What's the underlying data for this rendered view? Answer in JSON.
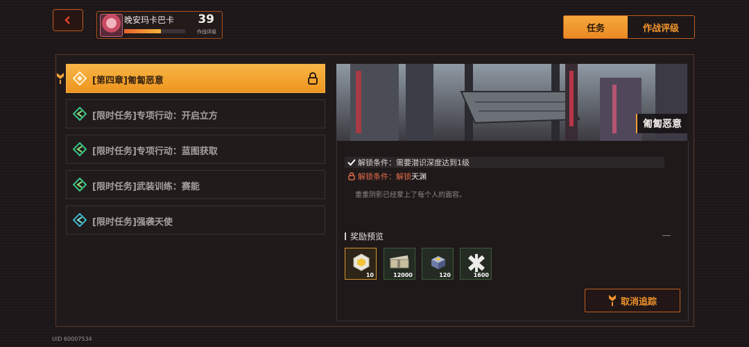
{
  "header": {
    "back_icon": "chevron-left-icon",
    "player": {
      "name": "晚安玛卡巴卡",
      "level": "39",
      "level_label": "作战评级",
      "progress": 0.6
    },
    "tabs": [
      {
        "label": "任务",
        "active": true
      },
      {
        "label": "作战评级",
        "active": false
      }
    ]
  },
  "missions": [
    {
      "label": "[第四章]匍匐恶意",
      "selected": true,
      "icon": "chapter-diamond-icon",
      "locked": true
    },
    {
      "label": "[限时任务]专项行动：开启立方",
      "selected": false,
      "icon": "limited-task-icon"
    },
    {
      "label": "[限时任务]专项行动：蓝图获取",
      "selected": false,
      "icon": "limited-task-icon"
    },
    {
      "label": "[限时任务]武装训练：赛能",
      "selected": false,
      "icon": "limited-task-icon"
    },
    {
      "label": "[限时任务]强袭天使",
      "selected": false,
      "icon": "limited-task-icon"
    }
  ],
  "detail": {
    "preview_title": "匍匐恶意",
    "conditions": [
      {
        "icon": "check-icon",
        "text": "解锁条件：需要潜识深度达到1级",
        "met": true
      },
      {
        "icon": "lock-icon",
        "prefix": "解锁条件：",
        "req": "解锁",
        "value": "天渊",
        "met": false
      }
    ],
    "description": "重重阴影已经蒙上了每个人的面容。",
    "reward_title": "奖励预览",
    "rewards": [
      {
        "icon": "cube-crystal-icon",
        "qty": "10",
        "rarity": "gold"
      },
      {
        "icon": "cash-bundle-icon",
        "qty": "12000",
        "rarity": "green"
      },
      {
        "icon": "material-chip-icon",
        "qty": "120",
        "rarity": "green"
      },
      {
        "icon": "exp-cross-icon",
        "qty": "1600",
        "rarity": "green"
      }
    ],
    "cancel_label": "取消追踪"
  },
  "uid": "UID 60007534",
  "colors": {
    "accent": "#f0932c",
    "selected": "#f3a83a"
  }
}
